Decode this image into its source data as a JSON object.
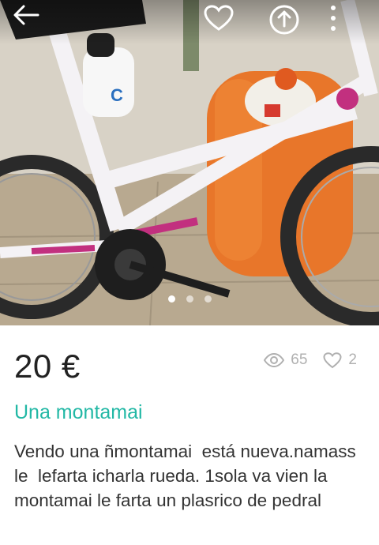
{
  "listing": {
    "price": "20 €",
    "views": "65",
    "likes": "2",
    "title": "Una montamai",
    "description": "Vendo una ñmontamai  está nueva.namass le  lefarta icharla rueda. 1sola va vien la montamai le farta un plasrico de pedral"
  },
  "gallery": {
    "image_count": 3,
    "active_index": 0
  },
  "icons": {
    "back": "back-arrow-icon",
    "favorite": "heart-icon",
    "share": "share-icon",
    "more": "more-vertical-icon",
    "views": "eye-icon",
    "likes": "heart-outline-icon"
  },
  "colors": {
    "title": "#22b8a5",
    "price": "#222222",
    "stats": "#b0b0b0"
  }
}
